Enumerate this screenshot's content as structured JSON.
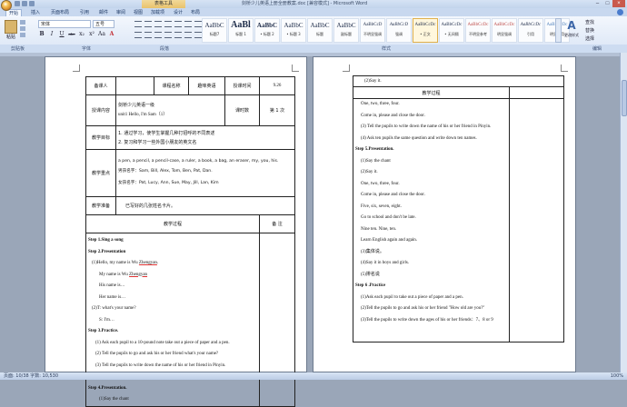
{
  "window": {
    "title": "剑桥少儿英语上册全册教案.doc [兼容模式] - Microsoft Word",
    "tools_tab": "表格工具",
    "controls": [
      "–",
      "□",
      "×"
    ]
  },
  "ribbon_tabs": [
    "开始",
    "插入",
    "页面布局",
    "引用",
    "邮件",
    "审阅",
    "视图",
    "加载项",
    "设计",
    "布局"
  ],
  "clipboard": {
    "paste_label": "粘贴"
  },
  "font": {
    "name": "宋体",
    "size": "五号",
    "fmt": [
      "B",
      "I",
      "U",
      "abe",
      "x₂",
      "x²",
      "Aa",
      "A"
    ]
  },
  "styles": [
    {
      "sample": "AaBbC",
      "name": "标题7"
    },
    {
      "sample": "AaBl",
      "name": "标题 1"
    },
    {
      "sample": "AaBbC",
      "name": "• 标题 2"
    },
    {
      "sample": "AaBbC",
      "name": "• 标题 3"
    },
    {
      "sample": "AaBbC",
      "name": "标题"
    },
    {
      "sample": "AaBbC",
      "name": "副标题"
    },
    {
      "sample": "AaBbCcD",
      "name": "不明显强调"
    },
    {
      "sample": "AaBbCcD",
      "name": "强调"
    },
    {
      "sample": "AaBbCcDc",
      "name": "• 正文"
    },
    {
      "sample": "AaBbCcDc",
      "name": "• 无间隔"
    },
    {
      "sample": "AaBbCcDc",
      "name": "不明显参考"
    },
    {
      "sample": "AaBbCcDc",
      "name": "明显强调"
    },
    {
      "sample": "AaBbCcDc",
      "name": "引用"
    },
    {
      "sample": "AaBbCcDc",
      "name": "明显引用"
    },
    {
      "sample": "AaBbCcDc",
      "name": "要点"
    }
  ],
  "change_styles": "更改样式",
  "editing": [
    "查找",
    "替换",
    "选择"
  ],
  "group_labels": [
    "剪贴板",
    "字体",
    "段落",
    "样式",
    "编辑"
  ],
  "status": {
    "left": "页面: 10/38   字数: 10,530",
    "right": "100%"
  },
  "page1": {
    "row1": {
      "teacher": "备课人",
      "course_label": "课程名称",
      "course": "趣味英语",
      "time_label": "授课时间",
      "date": "9.26"
    },
    "row2": {
      "label": "授课内容",
      "book": "剑桥少儿英语一级",
      "unit": "unit1 Hello, I'm Sam（1）",
      "hours_label": "课时数",
      "hours": "第    1    次"
    },
    "row3": {
      "label": "教学目标",
      "goals": [
        "1. 通过学习，使学生掌握几种打招呼的不同表述",
        "2. 复习和学习一些外国小朋友的英文名"
      ]
    },
    "row4": {
      "label": "教学重点",
      "vocab": "a pen, a pencil, a pencil-case, a ruler, a book, a bag, an eraser, my, you, his.",
      "boys": "男孩名字：Sam, Bill, Alex, Tom, Ben, Pat, Dan.",
      "girls": "女孩名字：Pat, Lucy, Ann, Sue, May, Jill, Lan, Kim"
    },
    "row5": {
      "label": "教学准备",
      "content": "已写好的几张姓名卡片。"
    },
    "row6": {
      "process": "教学过程",
      "notes": "备    注"
    },
    "lines": [
      "Step 1.Sing a song",
      "Step 2.Presentation",
      "  (1)Hello, my name is Wu Zhengyan.",
      "      My name is Wu Zhengyan.",
      "      His name is…",
      "      Her name is…",
      "  (2)T: what's your name?",
      "      S: I'm…",
      "Step 3.Practice.",
      "  (1) Ask each pupil to a 10-pound note take out a piece of paper and a pen.",
      "  (2) Tell the pupils to go and ask his or her friend what's your name?",
      "  (3) Tell the pupils to write down the name of his or her friend in Pinyin.",
      "  (4) Ask ten pupils the same question and write down ten names.",
      "Step 4.Presentation.",
      "      (1)Say the chant"
    ]
  },
  "page2": {
    "top_line": "(2)Say it.",
    "process_header": "教学过程",
    "lines": [
      "  One, two, three, four.",
      "  Come in, please and close the door.",
      "  (3) Tell the pupils to write down the name of his or her friend in Pinyin.",
      "  (4) Ask ten pupils the same question and write down ten names.",
      "Step 5.Presentation.",
      "  (1)Say the chant",
      "  (2)Say it.",
      "  One, two, three, four.",
      "  Come in, please and close the door.",
      "  Five, six, seven, eight.",
      "  Go to school and don't be late.",
      "  Nine ten. Nine, ten.",
      "  Learn English again and again.",
      "  (3)集体说。",
      "  (4)Say it in boys and girls.",
      "  (5)排名说",
      "Step 6 .Practice",
      "  (1)Ask each pupil to take out a piece of paper and a pen.",
      "  (2)Tell the pupils to go and ask his or her friend \"How old are you?\"",
      "  (3)Tell the pupils to write down the ages of his or her friends：7、8 or 9"
    ]
  }
}
